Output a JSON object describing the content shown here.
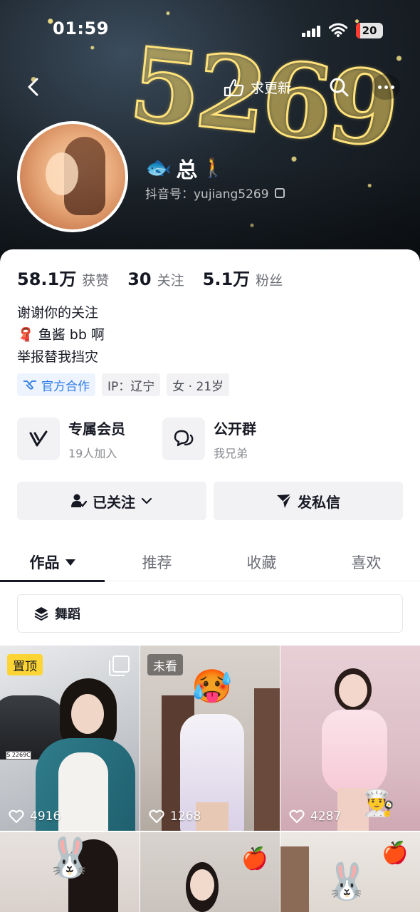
{
  "status_bar": {
    "time": "01:59",
    "battery": "20"
  },
  "nav": {
    "request_update": "求更新"
  },
  "cover": {
    "big_text": "5269"
  },
  "profile": {
    "name": "总",
    "douyin_id": "抖音号：yujiang5269",
    "stats": [
      {
        "value": "58.1万",
        "label": "获赞"
      },
      {
        "value": "30",
        "label": "关注"
      },
      {
        "value": "5.1万",
        "label": "粉丝"
      }
    ],
    "bio": [
      "谢谢你的关注",
      "鱼酱 bb 啊",
      "举报替我挡灾"
    ],
    "tags": {
      "official": "官方合作",
      "ip": "IP：辽宁",
      "gender_age": "女 · 21岁"
    }
  },
  "features": [
    {
      "title": "专属会员",
      "subtitle": "19人加入"
    },
    {
      "title": "公开群",
      "subtitle": "我兄弟"
    }
  ],
  "actions": {
    "following": "已关注",
    "message": "发私信"
  },
  "tabs": [
    {
      "label": "作品"
    },
    {
      "label": "推荐"
    },
    {
      "label": "收藏"
    },
    {
      "label": "喜欢"
    }
  ],
  "collection": {
    "label": "舞蹈"
  },
  "videos": [
    {
      "badge": "置顶",
      "likes": "4916",
      "plate": "S 2269C"
    },
    {
      "badge": "未看",
      "likes": "1268"
    },
    {
      "badge": "",
      "likes": "4287"
    }
  ]
}
